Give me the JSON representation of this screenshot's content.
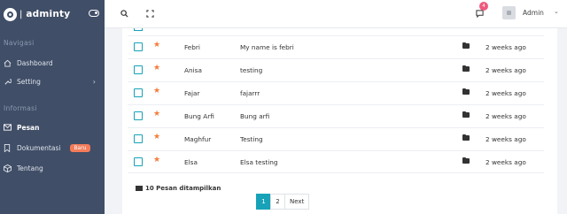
{
  "brand": {
    "name": "adminty",
    "separator": "|"
  },
  "sidebar": {
    "sections": [
      {
        "title": "Navigasi",
        "items": [
          {
            "label": "Dashboard",
            "icon": "home-icon"
          },
          {
            "label": "Setting",
            "icon": "wrench-icon",
            "chevron": "›"
          }
        ]
      },
      {
        "title": "Informasi",
        "items": [
          {
            "label": "Pesan",
            "icon": "mail-icon",
            "active": true
          },
          {
            "label": "Dokumentasi",
            "icon": "bookmark-icon",
            "badge": "Baru"
          },
          {
            "label": "Tentang",
            "icon": "box-icon"
          }
        ]
      }
    ]
  },
  "header": {
    "notification_count": "4",
    "user": "Admin"
  },
  "messages": [
    {
      "sender": "Febri",
      "subject": "My name is febri",
      "time": "2 weeks ago"
    },
    {
      "sender": "Anisa",
      "subject": "testing",
      "time": "2 weeks ago"
    },
    {
      "sender": "Fajar",
      "subject": "fajarrr",
      "time": "2 weeks ago"
    },
    {
      "sender": "Bung Arfi",
      "subject": "Bung arfi",
      "time": "2 weeks ago"
    },
    {
      "sender": "Maghfur",
      "subject": "Testing",
      "time": "2 weeks ago"
    },
    {
      "sender": "Elsa",
      "subject": "Elsa testing",
      "time": "2 weeks ago"
    }
  ],
  "footer": {
    "count_text": "10 Pesan ditampilkan"
  },
  "pagination": {
    "pages": [
      "1",
      "2"
    ],
    "active": "1",
    "next": "Next"
  },
  "colors": {
    "sidebar_bg": "#404e67",
    "accent": "#17a2b8",
    "star": "#f47c3a",
    "badge": "#f47c5a"
  }
}
